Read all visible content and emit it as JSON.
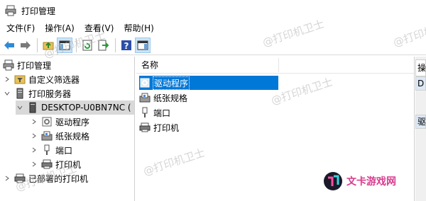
{
  "window": {
    "title": "打印管理",
    "icon": "printer-management-icon"
  },
  "menu": [
    {
      "label": "文件(F)"
    },
    {
      "label": "操作(A)"
    },
    {
      "label": "查看(V)"
    },
    {
      "label": "帮助(H)"
    }
  ],
  "toolbar": {
    "buttons": [
      "back-icon",
      "forward-icon",
      "up-folder-icon",
      "show-hide-tree-icon",
      "refresh-icon",
      "export-list-icon",
      "help-icon",
      "show-hide-action-pane-icon"
    ]
  },
  "tree": {
    "root": "打印管理",
    "custom_filters": "自定义筛选器",
    "print_servers": "打印服务器",
    "server": "DESKTOP-U0BN7NC (",
    "children": [
      "驱动程序",
      "纸张规格",
      "端口",
      "打印机"
    ],
    "deployed": "已部署的打印机"
  },
  "list": {
    "column_header": "名称",
    "items": [
      "驱动程序",
      "纸张规格",
      "端口",
      "打印机"
    ]
  },
  "right_pane": {
    "header": "操",
    "item1": "D",
    "item2": "驱"
  },
  "watermark": "@打印机卫士",
  "logo": {
    "text": "文卡游戏网"
  },
  "colors": {
    "selection": "#0078d7",
    "accent": "#d83c8e"
  }
}
